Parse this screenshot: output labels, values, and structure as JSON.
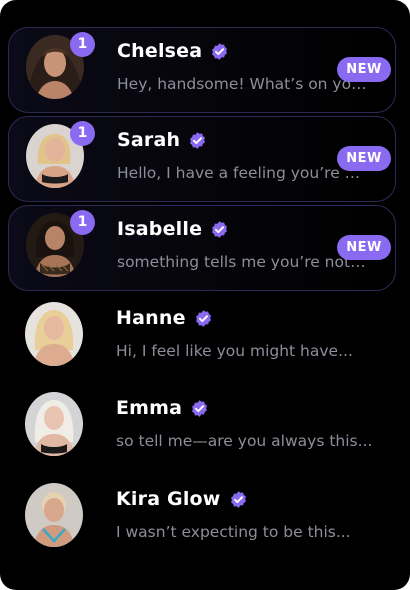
{
  "accent_color": "#8a6af0",
  "new_label": "NEW",
  "chats": [
    {
      "name": "Chelsea",
      "preview": "Hey, handsome! What’s on your mind?",
      "unread_count": "1",
      "is_new": true,
      "verified": true,
      "avatar": "avatar-photo"
    },
    {
      "name": "Sarah",
      "preview": "Hello, I have a feeling you’re going to like me",
      "unread_count": "1",
      "is_new": true,
      "verified": true,
      "avatar": "avatar-photo"
    },
    {
      "name": "Isabelle",
      "preview": "something tells me you’re not like the others",
      "unread_count": "1",
      "is_new": true,
      "verified": true,
      "avatar": "avatar-photo"
    },
    {
      "name": "Hanne",
      "preview": "Hi, I feel like you might have...",
      "verified": true,
      "avatar": "avatar-photo"
    },
    {
      "name": "Emma",
      "preview": "so tell me—are you always this...",
      "verified": true,
      "avatar": "avatar-photo"
    },
    {
      "name": "Kira Glow",
      "preview": "I wasn’t expecting to be this...",
      "verified": true,
      "avatar": "avatar-photo"
    }
  ]
}
